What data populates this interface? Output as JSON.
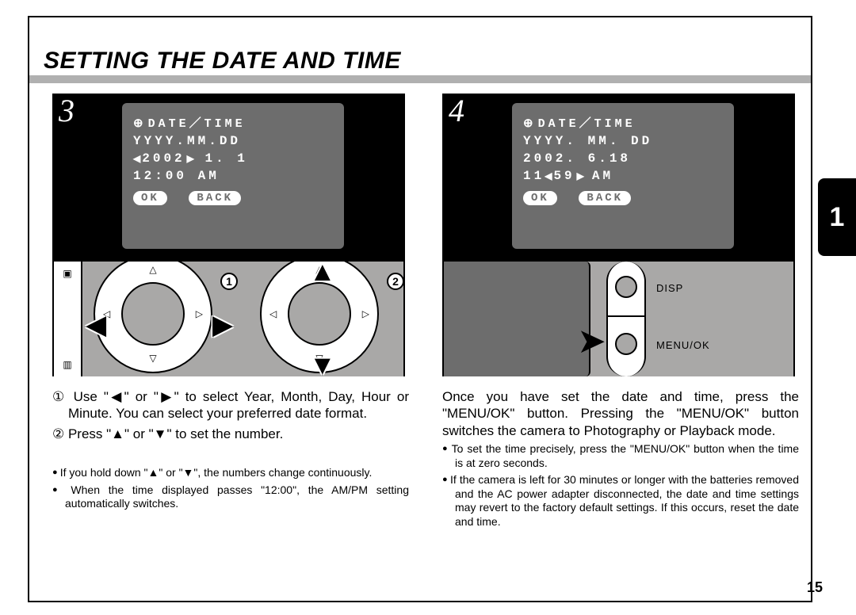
{
  "page": {
    "title": "SETTING THE DATE AND TIME",
    "side_tab": "1",
    "page_number": "15"
  },
  "step3": {
    "num": "3",
    "lcd": {
      "header": "DATE／TIME",
      "format": "YYYY.MM.DD",
      "year_sel": "2002",
      "rest_date": " 1. 1",
      "time": "12:00  AM",
      "ok": "OK",
      "back": "BACK"
    },
    "callout1": "1",
    "callout2": "2"
  },
  "step4": {
    "num": "4",
    "lcd": {
      "header": "DATE／TIME",
      "format": "YYYY. MM. DD",
      "date": "2002. 6.18",
      "hour": "11",
      "min_sel": "59",
      "ampm": "AM",
      "ok": "OK",
      "back": "BACK"
    },
    "btn_disp": "DISP",
    "btn_menu": "MENU/OK"
  },
  "text": {
    "l1": "① Use \"◀\" or \"▶\" to select Year, Month, Day, Hour or Minute. You can select your preferred date format.",
    "l2": "② Press \"▲\" or \"▼\" to set the number.",
    "l_note1": "If you hold down \"▲\" or \"▼\", the numbers change continuously.",
    "l_note2": "When the time displayed passes \"12:00\", the AM/PM setting automatically switches.",
    "r1": "Once you have set the date and time, press the \"MENU/OK\" button. Pressing the \"MENU/OK\" button switches the camera to Photography or Playback mode.",
    "r_note1": "To set the time precisely, press the \"MENU/OK\" button when the time is at zero seconds.",
    "r_note2": "If the camera is left for 30 minutes or longer with the batteries removed and the AC power adapter disconnected, the date and time settings may revert to the factory default settings. If this occurs, reset the date and time."
  }
}
